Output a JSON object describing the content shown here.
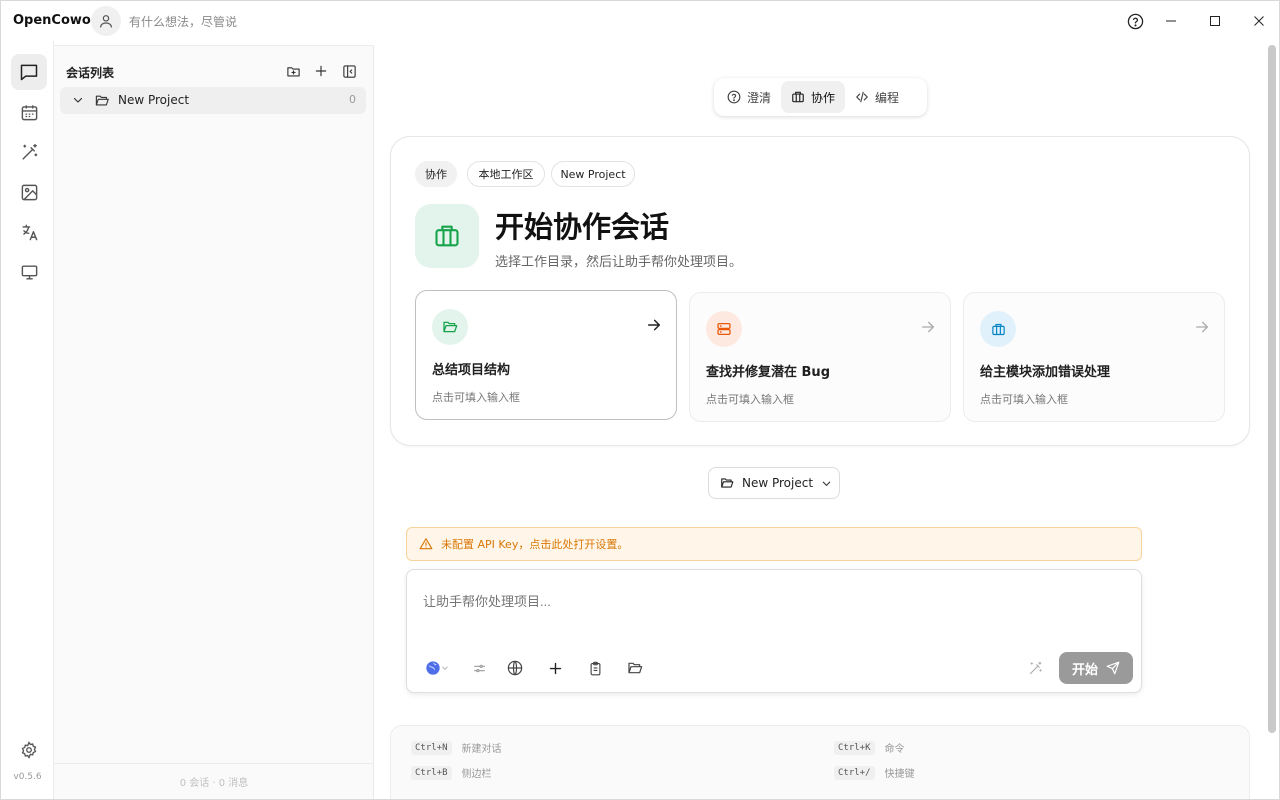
{
  "titlebar": {
    "app_name": "OpenCowork",
    "hint": "有什么想法，尽管说"
  },
  "rail": {
    "items": [
      "chat-icon",
      "calendar-icon",
      "magic-wand-icon",
      "image-icon",
      "translate-icon",
      "monitor-icon"
    ],
    "version": "v0.5.6"
  },
  "sidebar": {
    "title": "会话列表",
    "project": {
      "name": "New Project",
      "count": "0"
    },
    "footer": "0 会话 · 0 消息"
  },
  "modes": [
    {
      "label": "澄清",
      "icon": "question-icon"
    },
    {
      "label": "协作",
      "icon": "briefcase-icon",
      "active": true
    },
    {
      "label": "编程",
      "icon": "code-icon"
    }
  ],
  "card": {
    "chips": [
      "协作",
      "本地工作区",
      "New Project"
    ],
    "title": "开始协作会话",
    "subtitle": "选择工作目录，然后让助手帮你处理项目。",
    "suggestions": [
      {
        "title": "总结项目结构",
        "sub": "点击可填入输入框",
        "icon": "folder-open-icon",
        "color": "#16a34a"
      },
      {
        "title": "查找并修复潜在 Bug",
        "sub": "点击可填入输入框",
        "icon": "server-icon",
        "color": "#ea580c"
      },
      {
        "title": "给主模块添加错误处理",
        "sub": "点击可填入输入框",
        "icon": "briefcase-icon",
        "color": "#0284c7"
      }
    ]
  },
  "project_select": {
    "label": "New Project"
  },
  "warning": {
    "text": "未配置 API Key，点击此处打开设置。"
  },
  "composer": {
    "placeholder": "让助手帮你处理项目...",
    "send_label": "开始"
  },
  "shortcuts": [
    {
      "key": "Ctrl+N",
      "label": "新建对话"
    },
    {
      "key": "Ctrl+K",
      "label": "命令"
    },
    {
      "key": "Ctrl+B",
      "label": "侧边栏"
    },
    {
      "key": "Ctrl+/",
      "label": "快捷键"
    }
  ],
  "colors": {
    "accent_green": "#16a34a",
    "warning_text": "#d97706",
    "warning_bg": "#fff6e9"
  }
}
